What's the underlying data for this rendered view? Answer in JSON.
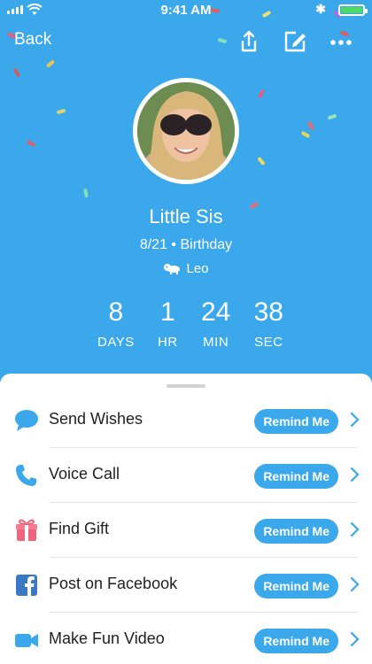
{
  "status_bar": {
    "time": "9:41 AM"
  },
  "nav": {
    "back_label": "Back",
    "share_icon": "share-icon",
    "edit_icon": "edit-icon",
    "more_icon": "more-icon"
  },
  "profile": {
    "name": "Little Sis",
    "date_line": "8/21 • Birthday",
    "zodiac": "Leo",
    "zodiac_icon": "leo-icon"
  },
  "countdown": [
    {
      "value": "8",
      "unit": "DAYS"
    },
    {
      "value": "1",
      "unit": "HR"
    },
    {
      "value": "24",
      "unit": "MIN"
    },
    {
      "value": "38",
      "unit": "SEC"
    }
  ],
  "actions": [
    {
      "label": "Send Wishes",
      "icon": "chat-bubble-icon",
      "button": "Remind Me"
    },
    {
      "label": "Voice Call",
      "icon": "phone-icon",
      "button": "Remind Me"
    },
    {
      "label": "Find Gift",
      "icon": "gift-icon",
      "button": "Remind Me"
    },
    {
      "label": "Post on Facebook",
      "icon": "facebook-icon",
      "button": "Remind Me"
    },
    {
      "label": "Make Fun Video",
      "icon": "video-camera-icon",
      "button": "Remind Me"
    }
  ],
  "colors": {
    "accent": "#3aa8eb",
    "gift": "#f0647d",
    "facebook": "#3b78c3"
  }
}
